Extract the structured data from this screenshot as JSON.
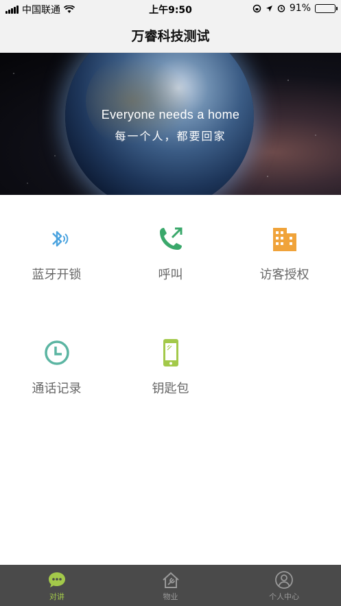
{
  "status_bar": {
    "carrier": "中国联通",
    "time": "上午9:50",
    "battery": "91%",
    "battery_level": 0.91
  },
  "nav": {
    "title": "万睿科技测试"
  },
  "banner": {
    "headline_en": "Everyone needs a home",
    "headline_cn": "每一个人，都要回家"
  },
  "grid": [
    {
      "label": "蓝牙开锁",
      "icon": "bluetooth-icon",
      "color": "#4aa3df"
    },
    {
      "label": "呼叫",
      "icon": "phone-call-icon",
      "color": "#3aa86b"
    },
    {
      "label": "访客授权",
      "icon": "building-icon",
      "color": "#f0a33a"
    },
    {
      "label": "通话记录",
      "icon": "clock-icon",
      "color": "#5bb5a2"
    },
    {
      "label": "钥匙包",
      "icon": "phone-device-icon",
      "color": "#a3c94a"
    }
  ],
  "tabs": [
    {
      "label": "对讲",
      "icon": "chat-bubble-icon",
      "active": true
    },
    {
      "label": "物业",
      "icon": "house-tools-icon",
      "active": false
    },
    {
      "label": "个人中心",
      "icon": "person-icon",
      "active": false
    }
  ],
  "colors": {
    "tab_active": "#a3c94a",
    "tab_bg": "#4a4a4a",
    "label_text": "#666666"
  }
}
